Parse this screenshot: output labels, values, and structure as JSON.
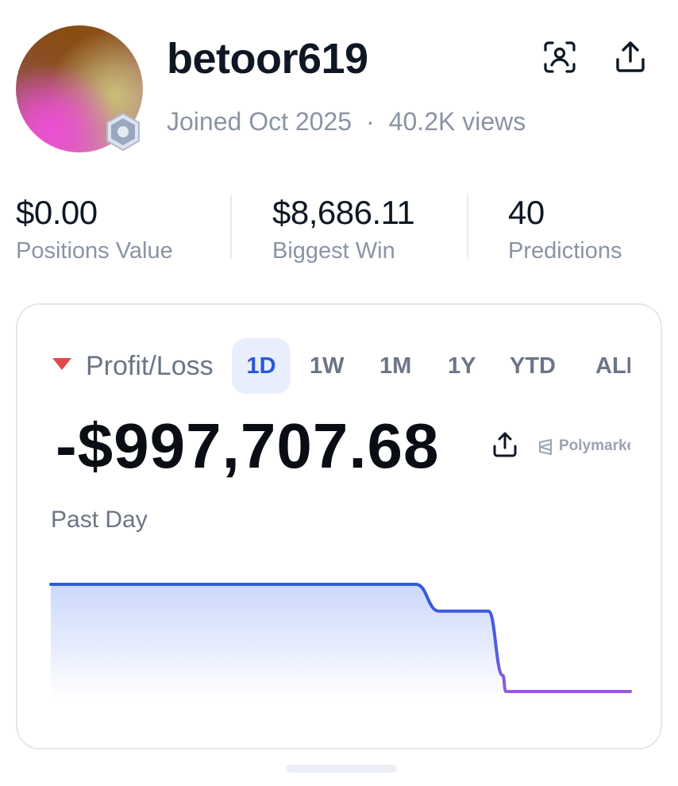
{
  "profile": {
    "username": "betoor619",
    "joined": "Joined Oct 2025",
    "views": "40.2K views",
    "separator": "·",
    "avatar_icon": "gradient-avatar",
    "badge_icon": "hexagon-badge-icon"
  },
  "header_icons": [
    "profile-scan-icon",
    "share-icon"
  ],
  "stats": [
    {
      "value": "$0.00",
      "label": "Positions Value"
    },
    {
      "value": "$8,686.11",
      "label": "Biggest Win"
    },
    {
      "value": "40",
      "label": "Predictions"
    }
  ],
  "pnl_card": {
    "title": "Profit/Loss",
    "trend": "down",
    "tabs": [
      "1D",
      "1W",
      "1M",
      "1Y",
      "YTD",
      "ALL"
    ],
    "active_tab": "1D",
    "value": "-$997,707.68",
    "brand": "Polymarket",
    "period": "Past Day"
  },
  "colors": {
    "accent": "#2a58d6",
    "loss_red": "#e24a4a",
    "line_start": "#2f5bd9",
    "line_end": "#9b5ad8",
    "muted": "#8a94a4"
  },
  "chart_data": {
    "type": "line",
    "title": "",
    "xlabel": "",
    "ylabel": "",
    "series": [
      {
        "x": [
          0,
          0.2,
          0.4,
          0.55,
          0.63,
          0.67,
          0.73,
          0.755,
          0.78,
          0.785,
          0.82,
          0.9,
          1.0
        ],
        "y": [
          0,
          0,
          0,
          0,
          0,
          -0.25,
          -0.25,
          -0.25,
          -0.85,
          -1.0,
          -1.0,
          -1.0,
          -1.0
        ]
      }
    ]
  }
}
